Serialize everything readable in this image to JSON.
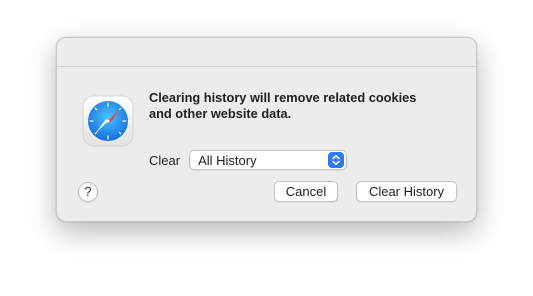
{
  "dialog": {
    "app_icon": "safari-compass-icon",
    "message_line1": "Clearing history will remove related cookies",
    "message_line2": "and other website data.",
    "clear_label": "Clear",
    "clear_select": {
      "selected": "All History",
      "stepper_icon": "up-down-chevron-icon"
    },
    "help_label": "?",
    "cancel_label": "Cancel",
    "confirm_label": "Clear History"
  },
  "colors": {
    "dialog_bg": "#ececec",
    "accent": "#2f7af6",
    "compass_blue": "#1e8ef0",
    "needle_red": "#ff3b30"
  }
}
